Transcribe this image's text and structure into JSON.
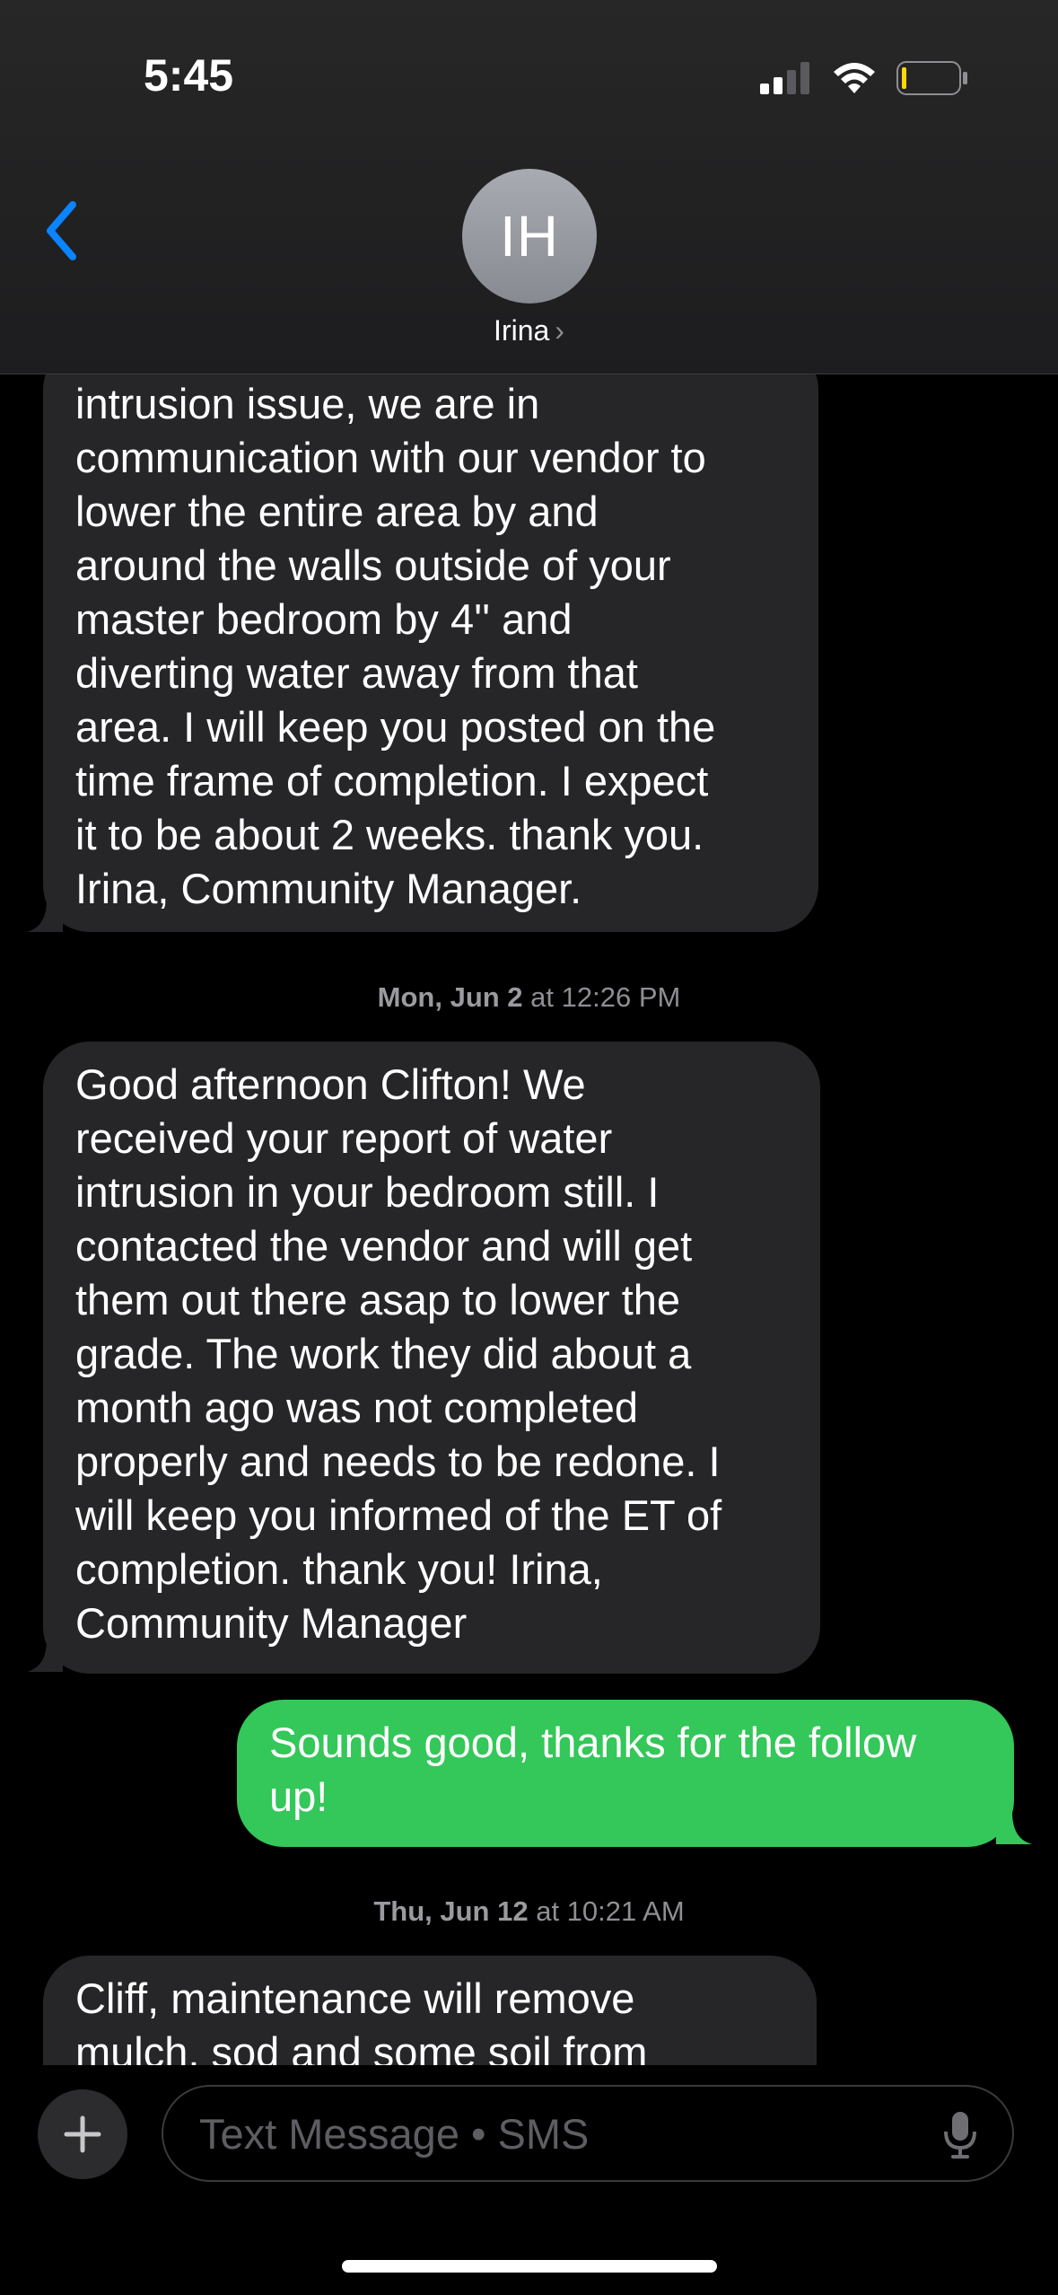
{
  "status_bar": {
    "time": "5:45"
  },
  "header": {
    "avatar_initials": "IH",
    "contact_name": "Irina",
    "contact_chevron": "›"
  },
  "messages": {
    "m1": {
      "text": "intrusion issue, we are in\ncommunication with our vendor to\nlower the entire area by and\naround the walls outside of your\nmaster bedroom by 4'' and\ndiverting water away from that\narea. I will keep you posted on the\ntime frame of completion. I expect\nit to be about 2 weeks. thank you.\nIrina, Community Manager."
    },
    "ts1": {
      "day": "Mon, Jun 2",
      "time": " at 12:26 PM"
    },
    "m2": {
      "text": "Good afternoon Clifton! We\nreceived your report of water\nintrusion in your bedroom still. I\ncontacted the vendor and will get\nthem out there asap to lower the\ngrade. The work they did about a\nmonth ago was not completed\nproperly and needs to be redone. I\nwill keep you informed of the ET of\ncompletion. thank you! Irina,\nCommunity Manager"
    },
    "m3": {
      "text": "Sounds good, thanks for the follow\nup!"
    },
    "ts2": {
      "day": "Thu, Jun 12",
      "time": " at 10:21 AM"
    },
    "m4": {
      "text": "Cliff, maintenance will remove\nmulch, sod and some soil from"
    }
  },
  "composer": {
    "placeholder": "Text Message • SMS"
  },
  "colors": {
    "incoming_bubble": "#262628",
    "outgoing_bubble": "#34c759",
    "accent": "#0a84ff"
  }
}
